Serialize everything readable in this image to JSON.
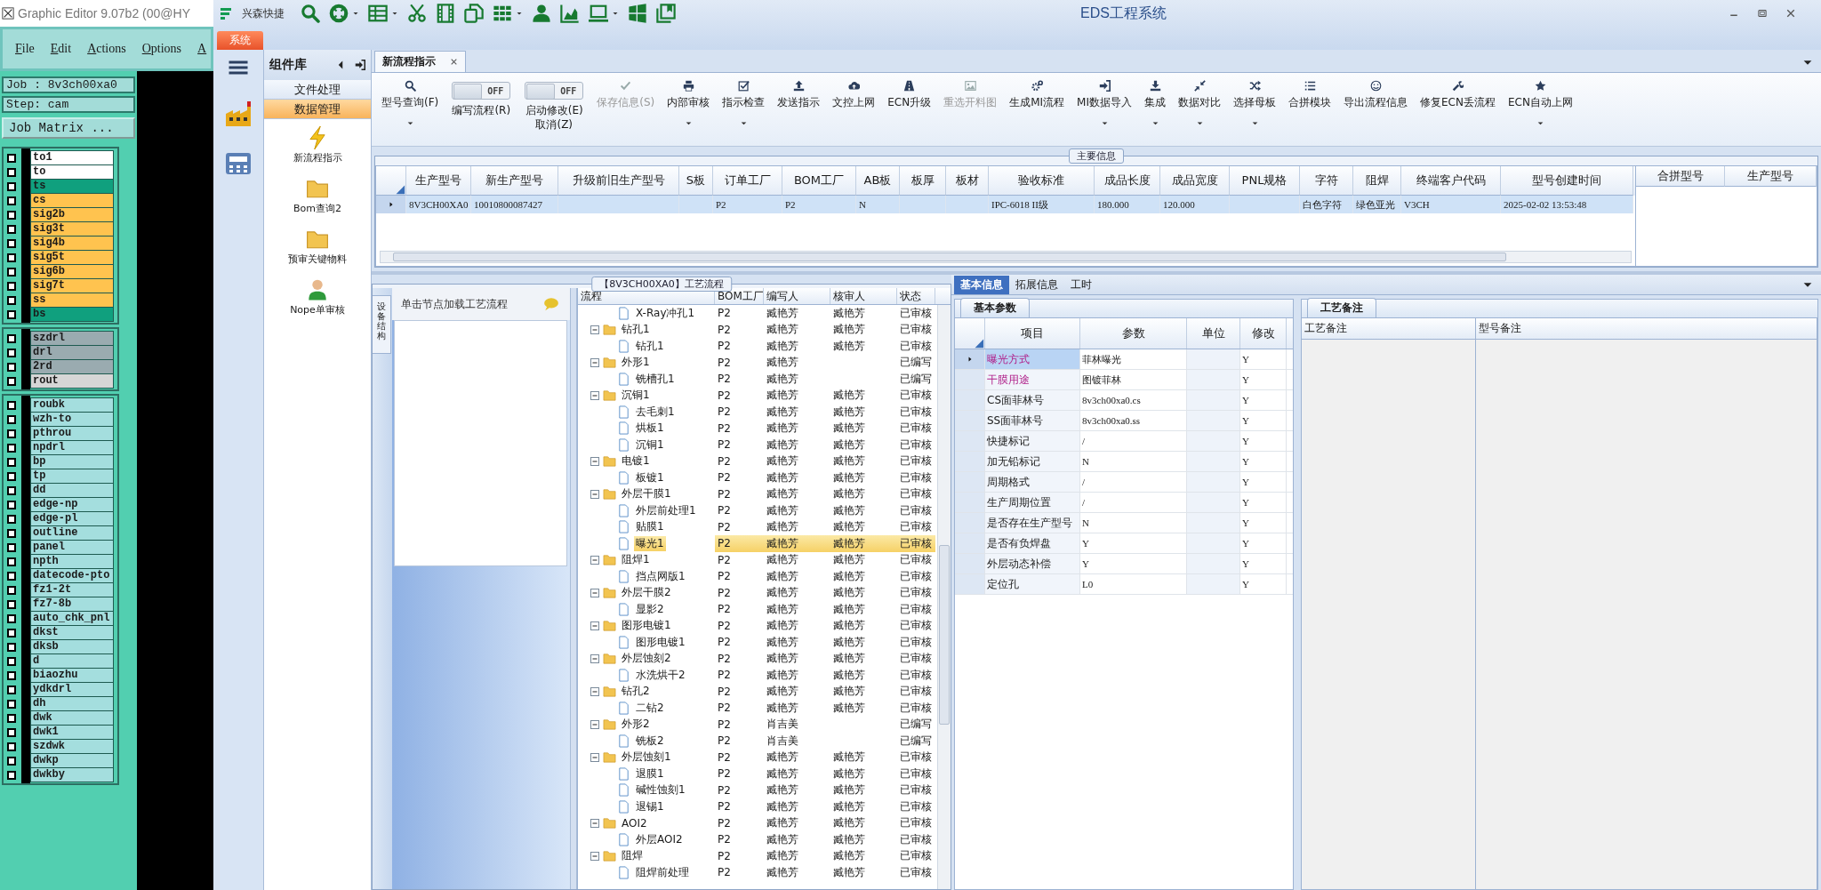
{
  "graphic_editor": {
    "title": "Graphic Editor 9.07b2 (00@HY",
    "menu": [
      "File",
      "Edit",
      "Actions",
      "Options",
      "A"
    ],
    "job": "Job : 8v3ch00xa0",
    "step": "Step: cam",
    "matrix_button": "Job Matrix ...",
    "layer_groups": [
      [
        {
          "name": "to1",
          "color": "#ffffff",
          "checked": false
        },
        {
          "name": "to",
          "color": "#ffffff",
          "checked": false
        },
        {
          "name": "ts",
          "color": "#10a07e",
          "checked": false
        },
        {
          "name": "cs",
          "color": "#ffc34f",
          "checked": false
        },
        {
          "name": "sig2b",
          "color": "#ffc34f",
          "checked": false
        },
        {
          "name": "sig3t",
          "color": "#ffc34f",
          "checked": false
        },
        {
          "name": "sig4b",
          "color": "#ffc34f",
          "checked": false
        },
        {
          "name": "sig5t",
          "color": "#ffc34f",
          "checked": false
        },
        {
          "name": "sig6b",
          "color": "#ffc34f",
          "checked": false
        },
        {
          "name": "sig7t",
          "color": "#ffc34f",
          "checked": false
        },
        {
          "name": "ss",
          "color": "#ffc34f",
          "checked": false
        },
        {
          "name": "bs",
          "color": "#10a07e",
          "checked": false
        }
      ],
      [
        {
          "name": "szdrl",
          "color": "#9aabb0",
          "checked": false
        },
        {
          "name": "drl",
          "color": "#9aabb0",
          "checked": false
        },
        {
          "name": "2rd",
          "color": "#9aabb0",
          "checked": false
        },
        {
          "name": "rout",
          "color": "#d6d6d6",
          "checked": false
        }
      ],
      [
        {
          "name": "roubk",
          "color": "#a4dede",
          "checked": false
        },
        {
          "name": "wzh-to",
          "color": "#a4dede",
          "checked": false
        },
        {
          "name": "pthrou",
          "color": "#a4dede",
          "checked": false
        },
        {
          "name": "npdrl",
          "color": "#a4dede",
          "checked": false
        },
        {
          "name": "bp",
          "color": "#a4dede",
          "checked": false
        },
        {
          "name": "tp",
          "color": "#a4dede",
          "checked": false
        },
        {
          "name": "dd",
          "color": "#a4dede",
          "checked": false
        },
        {
          "name": "edge-np",
          "color": "#a4dede",
          "checked": false
        },
        {
          "name": "edge-pl",
          "color": "#a4dede",
          "checked": false
        },
        {
          "name": "outline",
          "color": "#a4dede",
          "checked": false
        },
        {
          "name": "panel",
          "color": "#a4dede",
          "checked": false
        },
        {
          "name": "npth",
          "color": "#a4dede",
          "checked": false
        },
        {
          "name": "datecode-pto",
          "color": "#a4dede",
          "checked": false
        },
        {
          "name": "fz1-2t",
          "color": "#a4dede",
          "checked": false
        },
        {
          "name": "fz7-8b",
          "color": "#a4dede",
          "checked": false
        },
        {
          "name": "auto_chk_pnl",
          "color": "#a4dede",
          "checked": false
        },
        {
          "name": "dkst",
          "color": "#a4dede",
          "checked": false
        },
        {
          "name": "dksb",
          "color": "#a4dede",
          "checked": false
        },
        {
          "name": "d",
          "color": "#a4dede",
          "checked": false
        },
        {
          "name": "biaozhu",
          "color": "#a4dede",
          "checked": false
        },
        {
          "name": "ydkdrl",
          "color": "#a4dede",
          "checked": false
        },
        {
          "name": "dh",
          "color": "#a4dede",
          "checked": false
        },
        {
          "name": "dwk",
          "color": "#a4dede",
          "checked": false
        },
        {
          "name": "dwk1",
          "color": "#a4dede",
          "checked": false
        },
        {
          "name": "szdwk",
          "color": "#a4dede",
          "checked": false
        },
        {
          "name": "dwkp",
          "color": "#a4dede",
          "checked": false
        },
        {
          "name": "dwkby",
          "color": "#a4dede",
          "checked": false
        }
      ]
    ]
  },
  "app": {
    "brand": "兴森快捷",
    "title": "EDS工程系统",
    "system_tab": "系统",
    "library": {
      "title": "组件库",
      "sections": [
        {
          "label": "文件处理",
          "selected": false
        },
        {
          "label": "数据管理",
          "selected": true
        }
      ],
      "items": [
        "新流程指示",
        "Bom查询2",
        "预审关键物料",
        "Nope单审核"
      ]
    },
    "tabs": [
      {
        "label": "新流程指示",
        "selected": true
      }
    ],
    "toolbar": [
      {
        "kind": "button",
        "label": "型号查询(F)",
        "disabled": false,
        "dropdown": true
      },
      {
        "kind": "toggle",
        "lines": [
          "编写流程(R)"
        ],
        "on": false,
        "state": "OFF"
      },
      {
        "kind": "toggle",
        "lines": [
          "启动修改(E)",
          "取消(Z)"
        ],
        "on": false,
        "state": "OFF"
      },
      {
        "kind": "button",
        "label": "保存信息(S)",
        "disabled": true,
        "dropdown": false
      },
      {
        "kind": "button",
        "label": "内部审核",
        "disabled": false,
        "dropdown": true
      },
      {
        "kind": "button",
        "label": "指示检查",
        "disabled": false,
        "dropdown": true
      },
      {
        "kind": "button",
        "label": "发送指示",
        "disabled": false,
        "dropdown": false
      },
      {
        "kind": "button",
        "label": "文控上网",
        "disabled": false,
        "dropdown": false
      },
      {
        "kind": "button",
        "label": "ECN升级",
        "disabled": false,
        "dropdown": false
      },
      {
        "kind": "button",
        "label": "重选开料图",
        "disabled": true,
        "dropdown": false
      },
      {
        "kind": "button",
        "label": "生成MI流程",
        "disabled": false,
        "dropdown": false
      },
      {
        "kind": "button",
        "label": "MI数据导入",
        "disabled": false,
        "dropdown": true
      },
      {
        "kind": "button",
        "label": "集成",
        "disabled": false,
        "dropdown": true
      },
      {
        "kind": "button",
        "label": "数据对比",
        "disabled": false,
        "dropdown": true
      },
      {
        "kind": "button",
        "label": "选择母板",
        "disabled": false,
        "dropdown": true
      },
      {
        "kind": "button",
        "label": "合拼模块",
        "disabled": false,
        "dropdown": false
      },
      {
        "kind": "button",
        "label": "导出流程信息",
        "disabled": false,
        "dropdown": false
      },
      {
        "kind": "button",
        "label": "修复ECN丢流程",
        "disabled": false,
        "dropdown": false
      },
      {
        "kind": "button",
        "label": "ECN自动上网",
        "disabled": false,
        "dropdown": true
      }
    ],
    "main_info": {
      "title": "主要信息",
      "columns": [
        "生产型号",
        "新生产型号",
        "升级前旧生产型号",
        "S板",
        "订单工厂",
        "BOM工厂",
        "AB板",
        "板厚",
        "板材",
        "验收标准",
        "成品长度",
        "成品宽度",
        "PNL规格",
        "字符",
        "阻焊",
        "终端客户代码",
        "型号创建时间"
      ],
      "rows": [
        {
          "selected": true,
          "cells": [
            "8V3CH00XA0",
            "10010800087427",
            null,
            null,
            "P2",
            "P2",
            "N",
            null,
            null,
            "IPC-6018 II级",
            "180.000",
            "120.000",
            null,
            "白色字符",
            "绿色亚光",
            "V3CH",
            "2025-02-02 13:53:48"
          ]
        }
      ],
      "side_columns": [
        "合拼型号",
        "生产型号"
      ]
    },
    "flow": {
      "title": "【8V3CH00XA0】工艺流程",
      "side_tab": "设备结构",
      "hint": "单击节点加载工艺流程",
      "columns": [
        "流程",
        "BOM工厂",
        "编写人",
        "核审人",
        "状态"
      ],
      "tree": [
        {
          "kind": "step",
          "name": "X-Ray冲孔1",
          "bom": "P2",
          "writer": "臧艳芳",
          "reviewer": "臧艳芳",
          "status": "已审核",
          "selected": false
        },
        {
          "kind": "folder",
          "name": "钻孔1",
          "bom": "P2",
          "writer": "臧艳芳",
          "reviewer": "臧艳芳",
          "status": "已审核",
          "selected": false,
          "expanded": true,
          "children": [
            {
              "kind": "step",
              "name": "钻孔1",
              "bom": "P2",
              "writer": "臧艳芳",
              "reviewer": "臧艳芳",
              "status": "已审核",
              "selected": false
            }
          ]
        },
        {
          "kind": "folder",
          "name": "外形1",
          "bom": "P2",
          "writer": "臧艳芳",
          "status": "已编写",
          "selected": false,
          "expanded": true,
          "children": [
            {
              "kind": "step",
              "name": "铣槽孔1",
              "bom": "P2",
              "writer": "臧艳芳",
              "status": "已编写",
              "selected": false
            }
          ]
        },
        {
          "kind": "folder",
          "name": "沉铜1",
          "bom": "P2",
          "writer": "臧艳芳",
          "reviewer": "臧艳芳",
          "status": "已审核",
          "selected": false,
          "expanded": true,
          "children": [
            {
              "kind": "step",
              "name": "去毛刺1",
              "bom": "P2",
              "writer": "臧艳芳",
              "reviewer": "臧艳芳",
              "status": "已审核",
              "selected": false
            },
            {
              "kind": "step",
              "name": "烘板1",
              "bom": "P2",
              "writer": "臧艳芳",
              "reviewer": "臧艳芳",
              "status": "已审核",
              "selected": false
            },
            {
              "kind": "step",
              "name": "沉铜1",
              "bom": "P2",
              "writer": "臧艳芳",
              "reviewer": "臧艳芳",
              "status": "已审核",
              "selected": false
            }
          ]
        },
        {
          "kind": "folder",
          "name": "电镀1",
          "bom": "P2",
          "writer": "臧艳芳",
          "reviewer": "臧艳芳",
          "status": "已审核",
          "selected": false,
          "expanded": true,
          "children": [
            {
              "kind": "step",
              "name": "板镀1",
              "bom": "P2",
              "writer": "臧艳芳",
              "reviewer": "臧艳芳",
              "status": "已审核",
              "selected": false
            }
          ]
        },
        {
          "kind": "folder",
          "name": "外层干膜1",
          "bom": "P2",
          "writer": "臧艳芳",
          "reviewer": "臧艳芳",
          "status": "已审核",
          "selected": false,
          "expanded": true,
          "children": [
            {
              "kind": "step",
              "name": "外层前处理1",
              "bom": "P2",
              "writer": "臧艳芳",
              "reviewer": "臧艳芳",
              "status": "已审核",
              "selected": false
            },
            {
              "kind": "step",
              "name": "贴膜1",
              "bom": "P2",
              "writer": "臧艳芳",
              "reviewer": "臧艳芳",
              "status": "已审核",
              "selected": false
            },
            {
              "kind": "step",
              "name": "曝光1",
              "bom": "P2",
              "writer": "臧艳芳",
              "reviewer": "臧艳芳",
              "status": "已审核",
              "selected": true
            }
          ]
        },
        {
          "kind": "folder",
          "name": "阻焊1",
          "bom": "P2",
          "writer": "臧艳芳",
          "reviewer": "臧艳芳",
          "status": "已审核",
          "selected": false,
          "expanded": true,
          "children": [
            {
              "kind": "step",
              "name": "挡点网版1",
              "bom": "P2",
              "writer": "臧艳芳",
              "reviewer": "臧艳芳",
              "status": "已审核",
              "selected": false
            }
          ]
        },
        {
          "kind": "folder",
          "name": "外层干膜2",
          "bom": "P2",
          "writer": "臧艳芳",
          "reviewer": "臧艳芳",
          "status": "已审核",
          "selected": false,
          "expanded": true,
          "children": [
            {
              "kind": "step",
              "name": "显影2",
              "bom": "P2",
              "writer": "臧艳芳",
              "reviewer": "臧艳芳",
              "status": "已审核",
              "selected": false
            }
          ]
        },
        {
          "kind": "folder",
          "name": "图形电镀1",
          "bom": "P2",
          "writer": "臧艳芳",
          "reviewer": "臧艳芳",
          "status": "已审核",
          "selected": false,
          "expanded": true,
          "children": [
            {
              "kind": "step",
              "name": "图形电镀1",
              "bom": "P2",
              "writer": "臧艳芳",
              "reviewer": "臧艳芳",
              "status": "已审核",
              "selected": false
            }
          ]
        },
        {
          "kind": "folder",
          "name": "外层蚀刻2",
          "bom": "P2",
          "writer": "臧艳芳",
          "reviewer": "臧艳芳",
          "status": "已审核",
          "selected": false,
          "expanded": true,
          "children": [
            {
              "kind": "step",
              "name": "水洗烘干2",
              "bom": "P2",
              "writer": "臧艳芳",
              "reviewer": "臧艳芳",
              "status": "已审核",
              "selected": false
            }
          ]
        },
        {
          "kind": "folder",
          "name": "钻孔2",
          "bom": "P2",
          "writer": "臧艳芳",
          "reviewer": "臧艳芳",
          "status": "已审核",
          "selected": false,
          "expanded": true,
          "children": [
            {
              "kind": "step",
              "name": "二钻2",
              "bom": "P2",
              "writer": "臧艳芳",
              "reviewer": "臧艳芳",
              "status": "已审核",
              "selected": false
            }
          ]
        },
        {
          "kind": "folder",
          "name": "外形2",
          "bom": "P2",
          "writer": "肖吉美",
          "status": "已编写",
          "selected": false,
          "expanded": true,
          "children": [
            {
              "kind": "step",
              "name": "铣板2",
              "bom": "P2",
              "writer": "肖吉美",
              "status": "已编写",
              "selected": false
            }
          ]
        },
        {
          "kind": "folder",
          "name": "外层蚀刻1",
          "bom": "P2",
          "writer": "臧艳芳",
          "reviewer": "臧艳芳",
          "status": "已审核",
          "selected": false,
          "expanded": true,
          "children": [
            {
              "kind": "step",
              "name": "退膜1",
              "bom": "P2",
              "writer": "臧艳芳",
              "reviewer": "臧艳芳",
              "status": "已审核",
              "selected": false
            },
            {
              "kind": "step",
              "name": "碱性蚀刻1",
              "bom": "P2",
              "writer": "臧艳芳",
              "reviewer": "臧艳芳",
              "status": "已审核",
              "selected": false
            },
            {
              "kind": "step",
              "name": "退锡1",
              "bom": "P2",
              "writer": "臧艳芳",
              "reviewer": "臧艳芳",
              "status": "已审核",
              "selected": false
            }
          ]
        },
        {
          "kind": "folder",
          "name": "AOI2",
          "bom": "P2",
          "writer": "臧艳芳",
          "reviewer": "臧艳芳",
          "status": "已审核",
          "selected": false,
          "expanded": true,
          "children": [
            {
              "kind": "step",
              "name": "外层AOI2",
              "bom": "P2",
              "writer": "臧艳芳",
              "reviewer": "臧艳芳",
              "status": "已审核",
              "selected": false
            }
          ]
        },
        {
          "kind": "folder",
          "name": "阻焊",
          "bom": "P2",
          "writer": "臧艳芳",
          "reviewer": "臧艳芳",
          "status": "已审核",
          "selected": false,
          "expanded": true,
          "children": [
            {
              "kind": "step",
              "name": "阻焊前处理",
              "bom": "P2",
              "writer": "臧艳芳",
              "reviewer": "臧艳芳",
              "status": "已审核",
              "selected": false
            }
          ]
        }
      ]
    },
    "info_tabs": [
      {
        "label": "基本信息",
        "selected": true
      },
      {
        "label": "拓展信息",
        "selected": false
      },
      {
        "label": "工时",
        "selected": false
      }
    ],
    "params": {
      "tab": "基本参数",
      "columns": [
        "项目",
        "参数",
        "单位",
        "修改"
      ],
      "rows": [
        {
          "item": "曝光方式",
          "value": "菲林曝光",
          "modify": "Y",
          "highlighted": true,
          "selected": true
        },
        {
          "item": "干膜用途",
          "value": "图镀菲林",
          "modify": "Y",
          "highlighted": true,
          "selected": false
        },
        {
          "item": "CS面菲林号",
          "value": "8v3ch00xa0.cs",
          "modify": "Y",
          "highlighted": false,
          "selected": false
        },
        {
          "item": "SS面菲林号",
          "value": "8v3ch00xa0.ss",
          "modify": "Y",
          "highlighted": false,
          "selected": false
        },
        {
          "item": "快捷标记",
          "value": "/",
          "modify": "Y",
          "highlighted": false,
          "selected": false
        },
        {
          "item": "加无铅标记",
          "value": "N",
          "modify": "Y",
          "highlighted": false,
          "selected": false
        },
        {
          "item": "周期格式",
          "value": "/",
          "modify": "Y",
          "highlighted": false,
          "selected": false
        },
        {
          "item": "生产周期位置",
          "value": "/",
          "modify": "Y",
          "highlighted": false,
          "selected": false
        },
        {
          "item": "是否存在生产型号",
          "value": "N",
          "modify": "Y",
          "highlighted": false,
          "selected": false
        },
        {
          "item": "是否有负焊盘",
          "value": "Y",
          "modify": "Y",
          "highlighted": false,
          "selected": false
        },
        {
          "item": "外层动态补偿",
          "value": "Y",
          "modify": "Y",
          "highlighted": false,
          "selected": false
        },
        {
          "item": "定位孔",
          "value": "L0",
          "modify": "Y",
          "highlighted": false,
          "selected": false
        }
      ]
    },
    "remarks": {
      "tab": "工艺备注",
      "columns": [
        "工艺备注",
        "型号备注"
      ]
    }
  }
}
